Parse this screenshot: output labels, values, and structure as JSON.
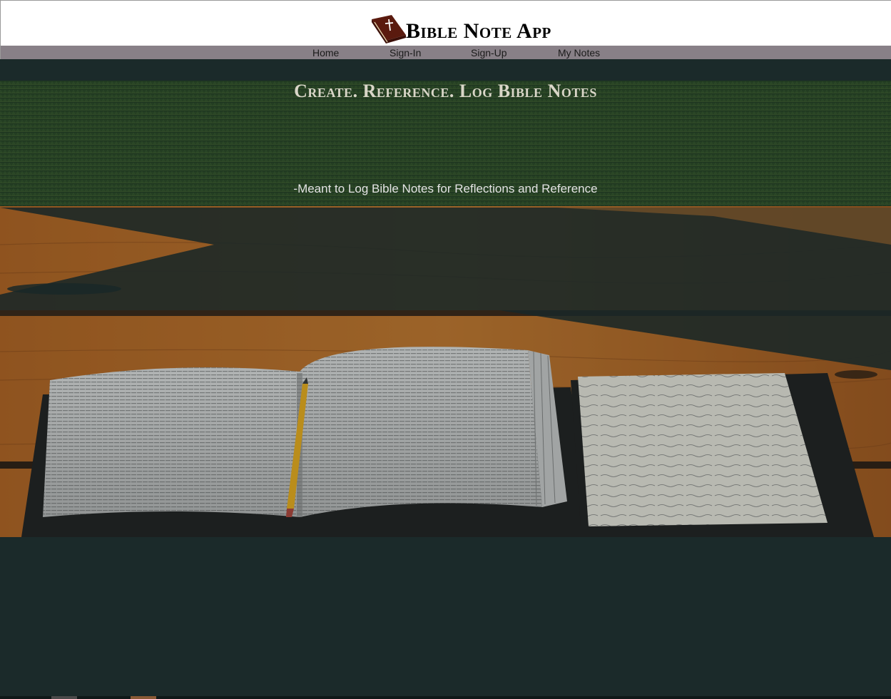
{
  "app": {
    "title": "Bible Note App"
  },
  "nav": {
    "items": [
      {
        "label": "Home"
      },
      {
        "label": "Sign-In"
      },
      {
        "label": "Sign-Up"
      },
      {
        "label": "My Notes"
      }
    ]
  },
  "hero": {
    "heading": "Create. Reference. Log Bible Notes",
    "subtitle": "-Meant to Log Bible Notes for Reflections and Reference"
  },
  "icons": {
    "brand": "bible-book-icon"
  },
  "colors": {
    "header_bg": "#ffffff",
    "nav_bg": "#888087",
    "page_bg": "#1b2a2a",
    "heading_text": "#d9d6c8",
    "bible_cover": "#5a1a0e"
  }
}
